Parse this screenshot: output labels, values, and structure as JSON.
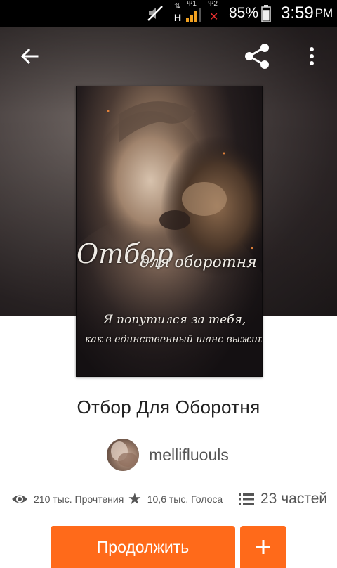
{
  "status_bar": {
    "network_label": "H",
    "sim1_label": "Ψ1",
    "sim2_label": "Ψ2",
    "battery_percent": "85%",
    "battery_level": 0.85,
    "time": "3:59",
    "ampm": "PM",
    "icons": [
      "mute-icon",
      "data-arrows-icon",
      "signal-icon",
      "no-signal-icon",
      "battery-icon"
    ]
  },
  "header": {
    "back_icon": "arrow-left-icon",
    "share_icon": "share-icon",
    "more_icon": "more-vertical-icon"
  },
  "cover": {
    "title_line1": "Отбор",
    "title_line2": "для оборотня",
    "tagline_line1": "Я попутился за тебя,",
    "tagline_line2": "как в единственный шанс выжить"
  },
  "story": {
    "title": "Отбор Для Оборотня",
    "author": "mellifluouls"
  },
  "stats": {
    "reads": "210 тыс. Прочтения",
    "votes": "10,6 тыс. Голоса",
    "parts": "23 частей",
    "icons": [
      "eye-icon",
      "star-icon",
      "list-icon"
    ]
  },
  "actions": {
    "continue_label": "Продолжить",
    "add_label": "+"
  },
  "colors": {
    "accent": "#ff6a1a",
    "statusbar": "#000000",
    "text_primary": "#222222",
    "text_secondary": "#555555"
  }
}
